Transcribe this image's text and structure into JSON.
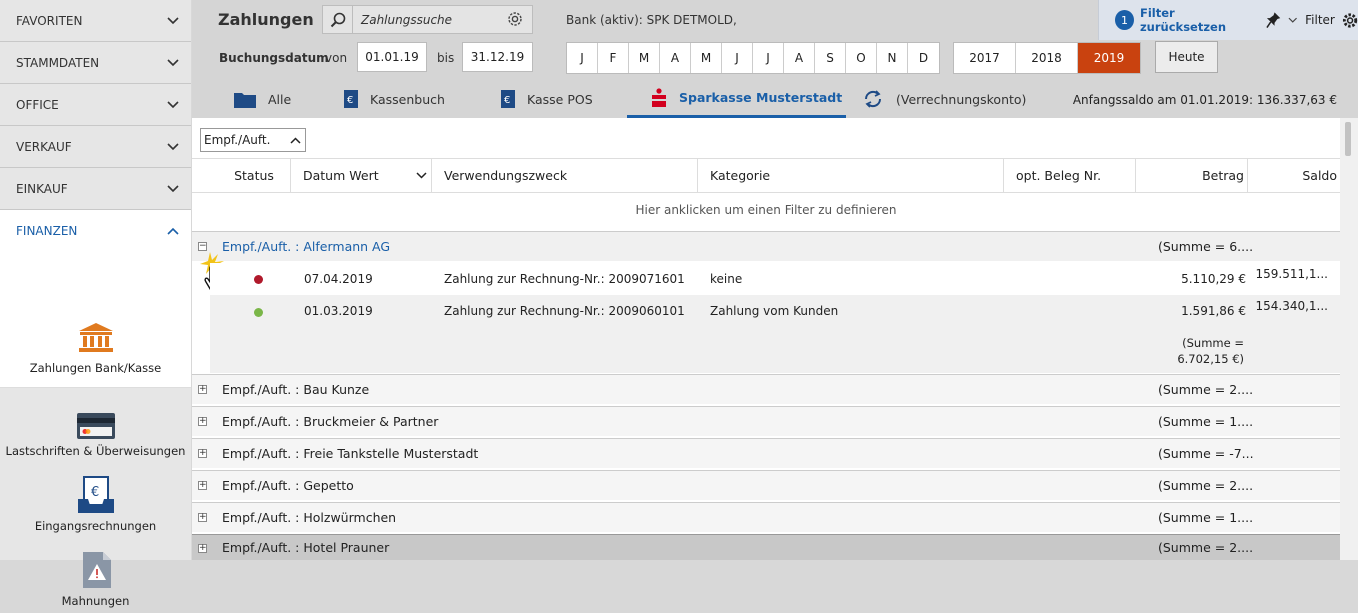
{
  "sidebar": {
    "sections": [
      {
        "label": "FAVORITEN"
      },
      {
        "label": "STAMMDATEN"
      },
      {
        "label": "OFFICE"
      },
      {
        "label": "VERKAUF"
      },
      {
        "label": "EINKAUF"
      },
      {
        "label": "FINANZEN"
      }
    ],
    "tiles": [
      {
        "label": "Zahlungen Bank/Kasse",
        "icon": "bank-icon"
      },
      {
        "label": "Lastschriften & Überweisungen",
        "icon": "credit-card-icon"
      },
      {
        "label": "Eingangsrechnungen",
        "icon": "invoice-tray-icon"
      },
      {
        "label": "Mahnungen",
        "icon": "warning-document-icon"
      }
    ]
  },
  "header": {
    "title": "Zahlungen",
    "search_placeholder": "Zahlungssuche",
    "bank": "Bank (aktiv): SPK DETMOLD,",
    "filter_count": "1",
    "filter_reset": "Filter zurücksetzen",
    "filter_label": "Filter"
  },
  "datefilter": {
    "label": "Buchungsdatum",
    "von": "von",
    "from": "01.01.19",
    "bis": "bis",
    "to": "31.12.19",
    "months": [
      "J",
      "F",
      "M",
      "A",
      "M",
      "J",
      "J",
      "A",
      "S",
      "O",
      "N",
      "D"
    ],
    "years": [
      "2017",
      "2018",
      "2019"
    ],
    "selected_year": "2019",
    "today": "Heute"
  },
  "tabs": [
    {
      "label": "Alle",
      "icon": "folder-icon"
    },
    {
      "label": "Kassenbuch",
      "icon": "euro-book-icon"
    },
    {
      "label": "Kasse POS",
      "icon": "euro-book-icon"
    },
    {
      "label": "Sparkasse Musterstadt",
      "icon": "sparkasse-icon"
    },
    {
      "label": "(Verrechnungskonto)",
      "icon": "exchange-icon"
    }
  ],
  "opening_balance": "Anfangssaldo am 01.01.2019: 136.337,63 €",
  "grouping": "Empf./Auft.",
  "columns": [
    "Status",
    "Datum Wert",
    "Verwendungszweck",
    "Kategorie",
    "opt. Beleg Nr.",
    "Betrag",
    "Saldo"
  ],
  "filter_hint": "Hier anklicken um einen Filter zu definieren",
  "expanded_group": {
    "name": "Empf./Auft. : Alfermann AG",
    "sum": "(Summe = 6....",
    "rows": [
      {
        "status": "red",
        "date": "07.04.2019",
        "purpose": "Zahlung zur Rechnung-Nr.: 2009071601",
        "category": "keine",
        "amount": "5.110,29 €",
        "balance": "159.511,1..."
      },
      {
        "status": "green",
        "date": "01.03.2019",
        "purpose": "Zahlung zur Rechnung-Nr.: 2009060101",
        "category": "Zahlung vom Kunden",
        "amount": "1.591,86 €",
        "balance": "154.340,1..."
      }
    ],
    "footer_sum_1": "(Summe =",
    "footer_sum_2": "6.702,15 €)"
  },
  "groups": [
    {
      "name": "Empf./Auft. : Bau Kunze",
      "sum": "(Summe = 2...."
    },
    {
      "name": "Empf./Auft. : Bruckmeier & Partner",
      "sum": "(Summe = 1...."
    },
    {
      "name": "Empf./Auft. : Freie Tankstelle Musterstadt",
      "sum": "(Summe = -7..."
    },
    {
      "name": "Empf./Auft. : Gepetto",
      "sum": "(Summe = 2...."
    },
    {
      "name": "Empf./Auft. : Holzwürmchen",
      "sum": "(Summe = 1...."
    },
    {
      "name": "Empf./Auft. : Hotel Prauner",
      "sum": "(Summe = 2...."
    }
  ],
  "colors": {
    "accent": "#1a5fa8",
    "selected_year": "#c9420f",
    "status_red": "#b0192b",
    "status_green": "#7ab648",
    "bank_icon": "#e07a1f"
  }
}
